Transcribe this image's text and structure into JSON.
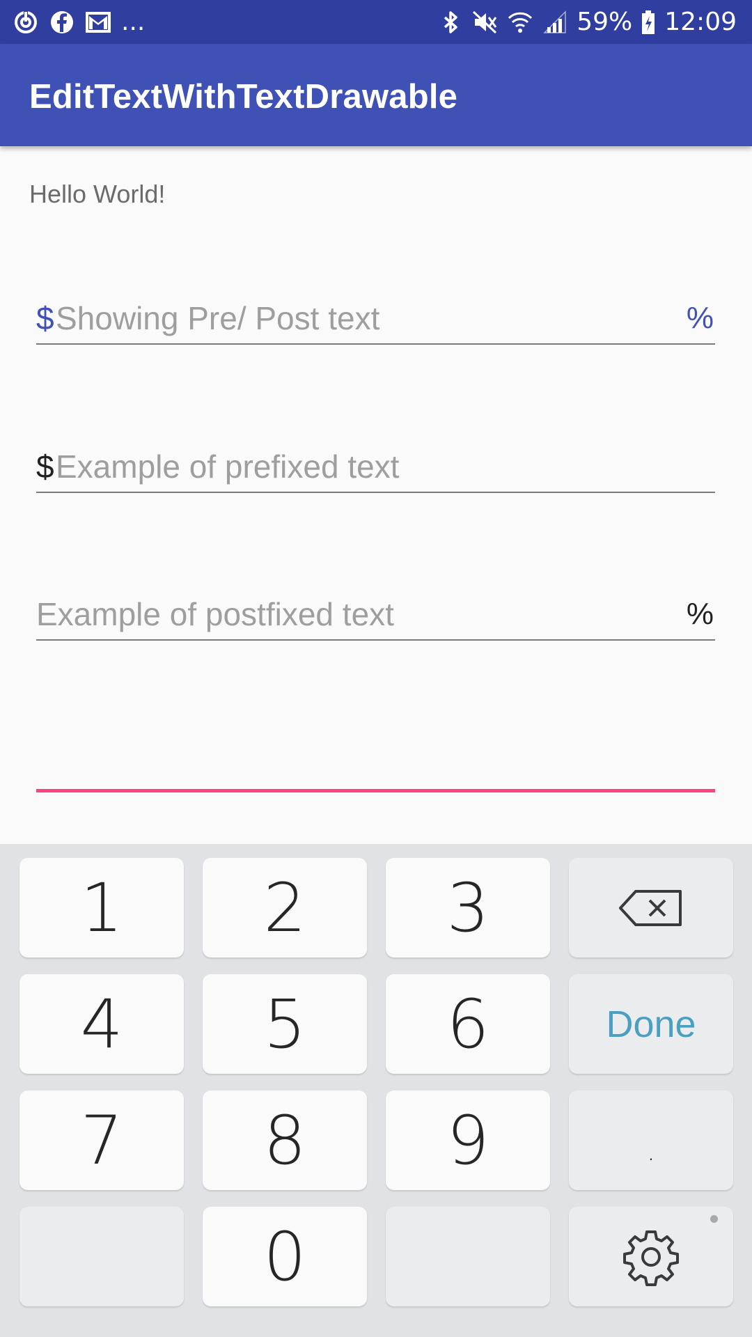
{
  "status_bar": {
    "left_icons": [
      "sync-icon",
      "facebook-icon",
      "gmail-icon"
    ],
    "more_indicator": "...",
    "right_icons": [
      "bluetooth-icon",
      "mute-icon",
      "wifi-icon",
      "signal-icon",
      "battery-icon"
    ],
    "battery_percent": "59%",
    "time": "12:09"
  },
  "app_bar": {
    "title": "EditTextWithTextDrawable"
  },
  "content": {
    "greeting": "Hello World!",
    "fields": [
      {
        "prefix": "$",
        "hint": "Showing Pre/ Post text",
        "suffix": "%",
        "accent_color": "#3f51b5"
      },
      {
        "prefix": "$",
        "hint": "Example of prefixed text",
        "suffix": "",
        "accent_color": "#212121"
      },
      {
        "prefix": "",
        "hint": "Example of postfixed text",
        "suffix": "%",
        "accent_color": "#212121"
      },
      {
        "prefix": "",
        "hint": "",
        "suffix": "",
        "focused": true,
        "underline_color": "#ff4081"
      }
    ]
  },
  "keyboard": {
    "keys": {
      "k1": "1",
      "k2": "2",
      "k3": "3",
      "k4": "4",
      "k5": "5",
      "k6": "6",
      "k7": "7",
      "k8": "8",
      "k9": "9",
      "k0": "0",
      "done": "Done",
      "dot": "."
    },
    "icons": {
      "backspace": "backspace-icon",
      "settings": "gear-icon"
    },
    "done_color": "#4aa0c0"
  },
  "colors": {
    "status_bar": "#303f9f",
    "app_bar": "#3f51b5",
    "accent": "#ff4081",
    "background": "#fafafa"
  }
}
